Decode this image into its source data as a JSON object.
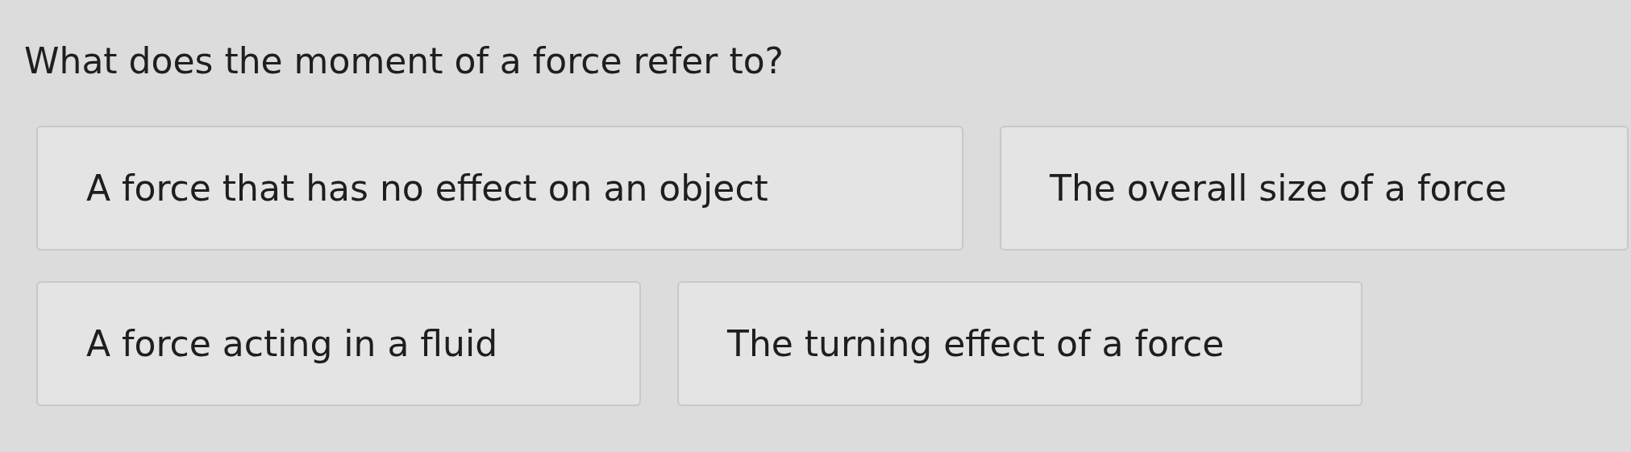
{
  "question": "What does the moment of a force refer to?",
  "answers": [
    {
      "text": "A force that has no effect on an object"
    },
    {
      "text": "The overall size of a force"
    },
    {
      "text": "A force acting in a fluid"
    },
    {
      "text": "The turning effect of a force"
    }
  ]
}
